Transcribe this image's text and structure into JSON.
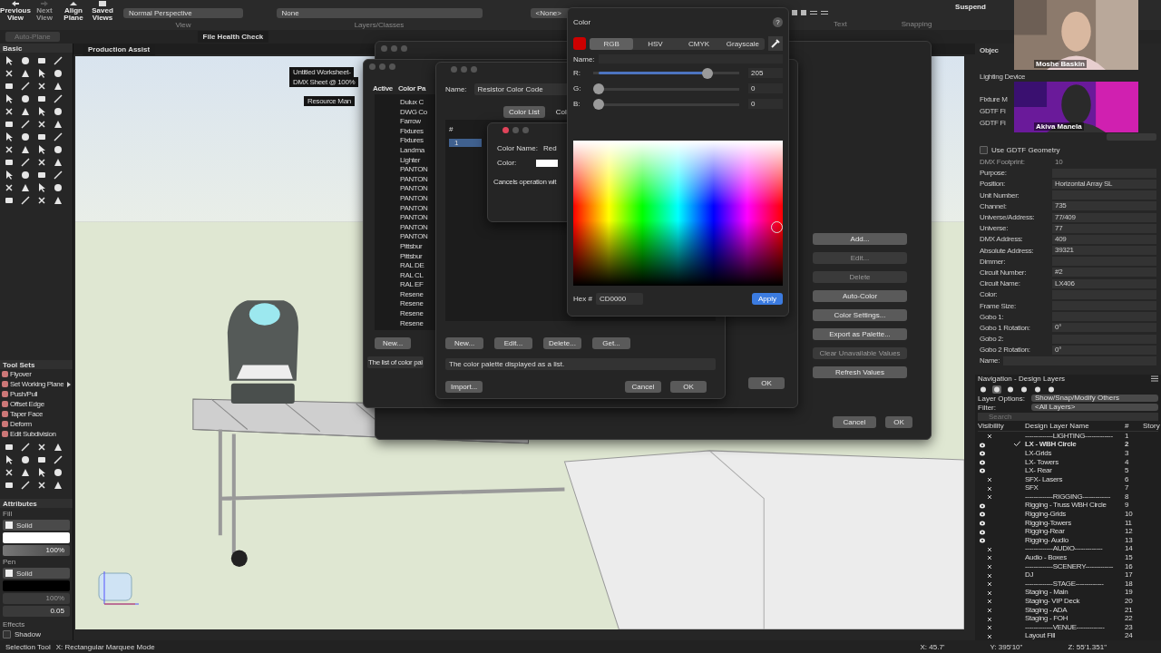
{
  "toolbar": {
    "buttons": [
      {
        "label": "Previous View",
        "disabled": false
      },
      {
        "label": "Next View",
        "disabled": true
      },
      {
        "label": "Align Plane",
        "disabled": false
      },
      {
        "label": "Saved Views",
        "disabled": false
      }
    ],
    "view_dropdown": "Normal Perspective",
    "layer_dropdown": "None",
    "class_dropdown": "<None>",
    "group_labels": [
      "View",
      "Layers/Classes"
    ],
    "right_labels": [
      "Text",
      "Snapping"
    ],
    "suspend": "Suspend",
    "auto_plane": "Auto-Plane"
  },
  "tabs": [
    "File Health Check",
    "Production Assist"
  ],
  "floating_palettes": [
    "Untitled Worksheet-",
    "DMX Sheet @ 100%",
    "Resource Man"
  ],
  "basic_palette": {
    "title": "Basic"
  },
  "tool_sets": {
    "title": "Tool Sets",
    "items": [
      {
        "label": "Flyover",
        "submenu": false
      },
      {
        "label": "Set Working Plane",
        "submenu": true
      },
      {
        "label": "Push/Pull",
        "submenu": false
      },
      {
        "label": "Offset Edge",
        "submenu": false
      },
      {
        "label": "Taper Face",
        "submenu": false
      },
      {
        "label": "Deform",
        "submenu": false
      },
      {
        "label": "Edit Subdivision",
        "submenu": false
      }
    ]
  },
  "attributes": {
    "title": "Attributes",
    "fill_label": "Fill",
    "fill_style": "Solid",
    "fill_opacity": "100%",
    "pen_label": "Pen",
    "pen_style": "Solid",
    "pen_opacity": "100%",
    "pen_weight": "0.05",
    "effects_label": "Effects",
    "shadow_label": "Shadow",
    "shadow_checked": false
  },
  "back_dialog": {
    "buttons": [
      {
        "label": "Add...",
        "disabled": false
      },
      {
        "label": "Edit...",
        "disabled": true
      },
      {
        "label": "Delete",
        "disabled": true
      },
      {
        "label": "Auto-Color",
        "disabled": false
      },
      {
        "label": "Color Settings...",
        "disabled": false
      },
      {
        "label": "Export as Palette...",
        "disabled": false
      },
      {
        "label": "Clear Unavailable Values",
        "disabled": true
      },
      {
        "label": "Refresh Values",
        "disabled": false
      }
    ],
    "cancel": "Cancel",
    "ok": "OK"
  },
  "palette_dialog": {
    "columns": [
      "Active",
      "Color Pa"
    ],
    "palettes": [
      "Dulux C",
      "DWG Co",
      "Farrow",
      "Fixtures",
      "Fixtures",
      "Landma",
      "Lighter",
      "PANTON",
      "PANTON",
      "PANTON",
      "PANTON",
      "PANTON",
      "PANTON",
      "PANTON",
      "PANTON",
      "Pittsbur",
      "Pittsbur",
      "RAL DE",
      "RAL CL",
      "RAL EF",
      "Resene",
      "Resene",
      "Resene",
      "Resene"
    ],
    "new": "New...",
    "description": "The list of color pal",
    "ok": "OK"
  },
  "edit_dialog": {
    "name_label": "Name:",
    "name_value": "Resistor Color Code",
    "tabs": [
      {
        "label": "Color List",
        "selected": true
      },
      {
        "label": "Col",
        "selected": false
      }
    ],
    "list_header": "#",
    "rows": [
      {
        "number": "1",
        "selected": true
      }
    ],
    "buttons": [
      "New...",
      "Edit...",
      "Delete...",
      "Get..."
    ],
    "description": "The color palette displayed as a list.",
    "import": "Import...",
    "cancel": "Cancel",
    "ok": "OK"
  },
  "color_name_dialog": {
    "name_label": "Color Name:",
    "name_value": "Red",
    "color_label": "Color:",
    "hint": "Cancels operation wit"
  },
  "color_picker": {
    "title": "Color",
    "help": "?",
    "modes": [
      {
        "label": "RGB",
        "selected": true
      },
      {
        "label": "HSV",
        "selected": false
      },
      {
        "label": "CMYK",
        "selected": false
      },
      {
        "label": "Grayscale",
        "selected": false
      }
    ],
    "name_label": "Name:",
    "channels": [
      {
        "label": "R:",
        "level": 0.804,
        "value": "205"
      },
      {
        "label": "G:",
        "level": 0,
        "value": "0"
      },
      {
        "label": "B:",
        "level": 0,
        "value": "0"
      }
    ],
    "hex_label": "Hex #",
    "hex": "CD0000",
    "apply": "Apply"
  },
  "participants": [
    {
      "name": "Moshe Baskin"
    },
    {
      "name": "Akiva Manela"
    }
  ],
  "object_info": {
    "title": "Objec",
    "type": "Lighting Device",
    "partial_labels": [
      "Fixture M",
      "GDTF Fi",
      "GDTF Fi"
    ],
    "gdtf_geometry": {
      "label": "Use GDTF Geometry",
      "checked": false
    },
    "fields": [
      {
        "label": "DMX Footprint:",
        "value": "10",
        "disabled": true
      },
      {
        "label": "Purpose:",
        "disabled": false
      },
      {
        "label": "Position:",
        "value": "Horizontal Array SL",
        "disabled": false
      },
      {
        "label": "Unit Number:",
        "disabled": false
      },
      {
        "label": "Channel:",
        "value": "735",
        "disabled": false
      },
      {
        "label": "Universe/Address:",
        "value": "77/409",
        "disabled": false
      },
      {
        "label": "Universe:",
        "value": "77",
        "disabled": false
      },
      {
        "label": "DMX Address:",
        "value": "409",
        "disabled": false
      },
      {
        "label": "Absolute Address:",
        "value": "39321",
        "disabled": false
      },
      {
        "label": "Dimmer:",
        "disabled": false
      },
      {
        "label": "Circuit Number:",
        "value": "#2",
        "disabled": false
      },
      {
        "label": "Circuit Name:",
        "value": "LX406",
        "disabled": false
      },
      {
        "label": "Color:",
        "disabled": false
      },
      {
        "label": "Frame Size:",
        "disabled": false
      },
      {
        "label": "Gobo 1:",
        "disabled": false
      },
      {
        "label": "Gobo 1 Rotation:",
        "value": "0°",
        "disabled": false
      },
      {
        "label": "Gobo 2:",
        "disabled": false
      },
      {
        "label": "Gobo 2 Rotation:",
        "value": "0°",
        "disabled": false
      }
    ],
    "name_label": "Name:"
  },
  "navigation": {
    "title": "Navigation - Design Layers",
    "layer_options_label": "Layer Options:",
    "layer_options": "Show/Snap/Modify Others",
    "filter_label": "Filter:",
    "filter": "<All Layers>",
    "search_placeholder": "Search",
    "columns": [
      "Visibility",
      "Design Layer Name",
      "#",
      "Story"
    ],
    "layers": [
      {
        "name": "-------------LIGHTING-------------",
        "number": "1",
        "visible": false,
        "active": false
      },
      {
        "name": "LX - WBH Circle",
        "number": "2",
        "visible": true,
        "active": true
      },
      {
        "name": "LX-Grids",
        "number": "3",
        "visible": true,
        "active": false
      },
      {
        "name": "LX- Towers",
        "number": "4",
        "visible": true,
        "active": false
      },
      {
        "name": "LX- Rear",
        "number": "5",
        "visible": true,
        "active": false
      },
      {
        "name": "SFX- Lasers",
        "number": "6",
        "visible": false,
        "active": false
      },
      {
        "name": "SFX",
        "number": "7",
        "visible": false,
        "active": false
      },
      {
        "name": "-------------RIGGING-------------",
        "number": "8",
        "visible": false,
        "active": false
      },
      {
        "name": "Rigging - Truss WBH Circle",
        "number": "9",
        "visible": true,
        "active": false
      },
      {
        "name": "Rigging-Grids",
        "number": "10",
        "visible": true,
        "active": false
      },
      {
        "name": "Rigging-Towers",
        "number": "11",
        "visible": true,
        "active": false
      },
      {
        "name": "Rigging-Rear",
        "number": "12",
        "visible": true,
        "active": false
      },
      {
        "name": "Rigging- Audio",
        "number": "13",
        "visible": true,
        "active": false
      },
      {
        "name": "-------------AUDIO-------------",
        "number": "14",
        "visible": false,
        "active": false
      },
      {
        "name": "Audio - Boxes",
        "number": "15",
        "visible": false,
        "active": false
      },
      {
        "name": "-------------SCENERY-------------",
        "number": "16",
        "visible": false,
        "active": false
      },
      {
        "name": "DJ",
        "number": "17",
        "visible": false,
        "active": false
      },
      {
        "name": "-------------STAGE-------------",
        "number": "18",
        "visible": false,
        "active": false
      },
      {
        "name": "Staging - Main",
        "number": "19",
        "visible": false,
        "active": false
      },
      {
        "name": "Staging- VIP Deck",
        "number": "20",
        "visible": false,
        "active": false
      },
      {
        "name": "Staging - ADA",
        "number": "21",
        "visible": false,
        "active": false
      },
      {
        "name": "Staging - FOH",
        "number": "22",
        "visible": false,
        "active": false
      },
      {
        "name": "-------------VENUE-------------",
        "number": "23",
        "visible": false,
        "active": false
      },
      {
        "name": "Layout Fill",
        "number": "24",
        "visible": false,
        "active": false
      }
    ]
  },
  "status_bar": {
    "tool": "Selection Tool",
    "mode": "X:  Rectangular Marquee Mode",
    "coords": [
      "X: 45.7'",
      "Y: 395'10\"",
      "Z: 55'1.351\""
    ]
  }
}
